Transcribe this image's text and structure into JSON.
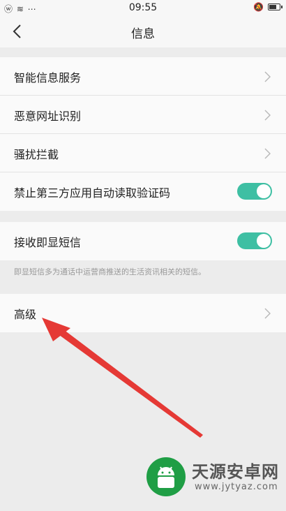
{
  "status_bar": {
    "left_icons": "ⓦ ≋ ⋯",
    "time": "09:55",
    "right_icons": "🔕"
  },
  "header": {
    "title": "信息"
  },
  "sections": {
    "main": [
      {
        "label": "智能信息服务",
        "control": "chevron"
      },
      {
        "label": "恶意网址识别",
        "control": "chevron"
      },
      {
        "label": "骚扰拦截",
        "control": "chevron"
      },
      {
        "label": "禁止第三方应用自动读取验证码",
        "control": "toggle",
        "on": true
      }
    ],
    "flash": {
      "label": "接收即显短信",
      "control": "toggle",
      "on": true
    },
    "flash_note": "即显短信多为通话中运营商推送的生活资讯相关的短信。",
    "advanced": {
      "label": "高级",
      "control": "chevron"
    }
  },
  "watermark": {
    "name": "天源安卓网",
    "url": "www.jytyaz.com"
  },
  "colors": {
    "accent": "#3ebfa3",
    "background": "#ececec",
    "row_bg": "#fafafa",
    "annotation_arrow": "#e53935",
    "watermark_green": "#1f9e45"
  }
}
